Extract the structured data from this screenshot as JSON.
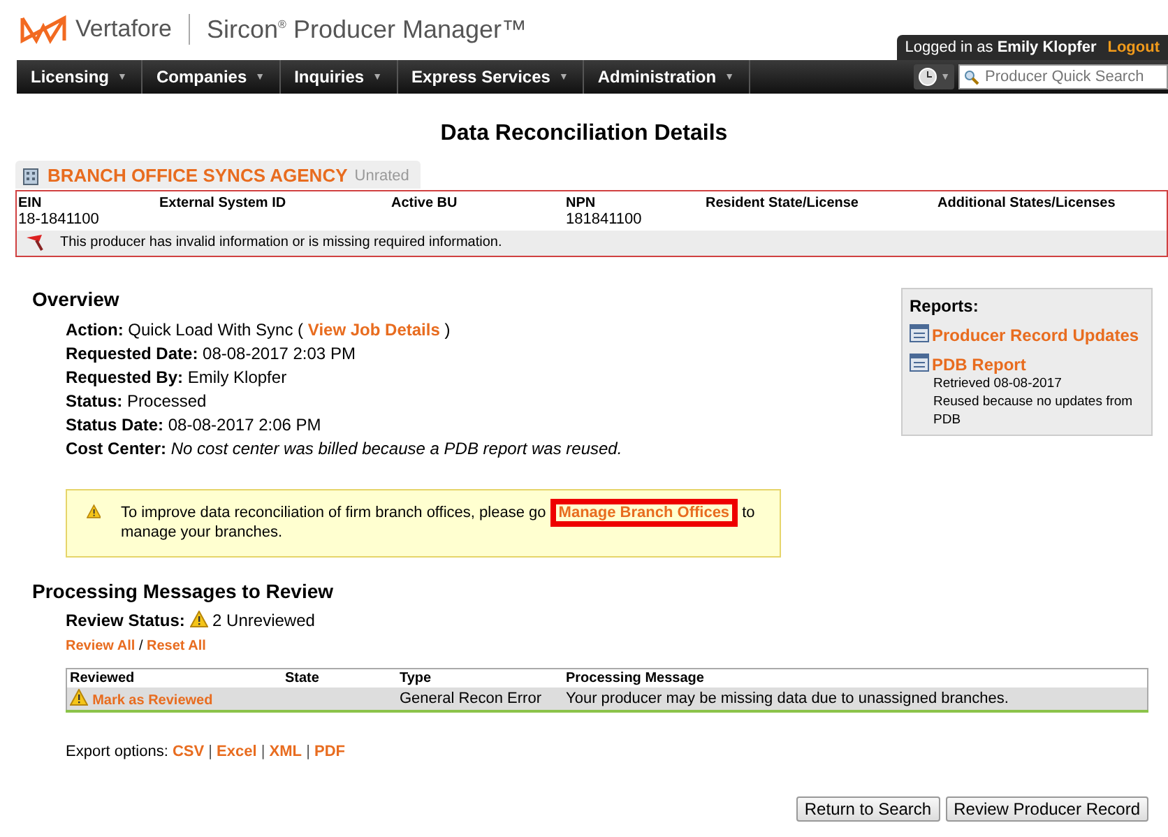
{
  "header": {
    "brand": "Vertafore",
    "product": "Sircon",
    "product_mark": "®",
    "product_rest": "Producer Manager™",
    "login_prefix": "Logged in as",
    "user": "Emily Klopfer",
    "logout": "Logout"
  },
  "nav": {
    "caret": "▼",
    "items": [
      "Licensing",
      "Companies",
      "Inquiries",
      "Express Services",
      "Administration"
    ],
    "search": {
      "placeholder": "Producer Quick Search"
    }
  },
  "page_title": "Data Reconciliation Details",
  "producer": {
    "name": "BRANCH OFFICE SYNCS AGENCY",
    "rating": "Unrated",
    "columns": [
      {
        "label": "EIN",
        "value": "18-1841100"
      },
      {
        "label": "External System ID"
      },
      {
        "label": "Active BU"
      },
      {
        "label": "NPN",
        "value": "181841100"
      },
      {
        "label": "Resident State/License"
      },
      {
        "label": "Additional States/Licenses"
      }
    ],
    "warning": "This producer has invalid information or is missing required information."
  },
  "overview": {
    "title": "Overview",
    "fields": [
      {
        "label": "Action:",
        "value": "Quick Load With Sync (",
        "link": "View Job Details",
        "suffix": ")",
        "italic": false
      },
      {
        "label": "Requested Date:",
        "value": "08-08-2017 2:03 PM",
        "italic": false
      },
      {
        "label": "Requested By:",
        "value": "Emily Klopfer",
        "italic": false
      },
      {
        "label": "Status:",
        "value": "Processed",
        "italic": false
      },
      {
        "label": "Status Date:",
        "value": "08-08-2017 2:06 PM",
        "italic": false
      },
      {
        "label": "Cost Center:",
        "value": "No cost center was billed because a PDB report was reused.",
        "italic": true
      }
    ],
    "notice": {
      "before": "To improve data reconciliation of firm branch offices, please go",
      "link": "Manage Branch Offices",
      "after": "to manage your branches.",
      "highlighted": true
    }
  },
  "reports": {
    "title": "Reports:",
    "items": [
      {
        "label": "Producer Record Updates"
      },
      {
        "label": "PDB Report",
        "notes": [
          "Retrieved 08-08-2017",
          "Reused because no updates from PDB"
        ]
      }
    ]
  },
  "messages": {
    "title": "Processing Messages to Review",
    "status_label": "Review Status:",
    "status": "2 Unreviewed",
    "review_all": "Review All",
    "separator": "/",
    "reset_all": "Reset All",
    "columns": [
      "Reviewed",
      "State",
      "Type",
      "Processing Message"
    ],
    "rows": [
      {
        "action": "Mark as Reviewed",
        "state": "",
        "type": "General Recon Error",
        "message": "Your producer may be missing data due to unassigned branches."
      }
    ]
  },
  "export": {
    "label": "Export options:",
    "options": [
      "CSV",
      "Excel",
      "XML",
      "PDF"
    ],
    "separator": "|"
  },
  "buttons": [
    "Return to Search",
    "Review Producer Record"
  ]
}
